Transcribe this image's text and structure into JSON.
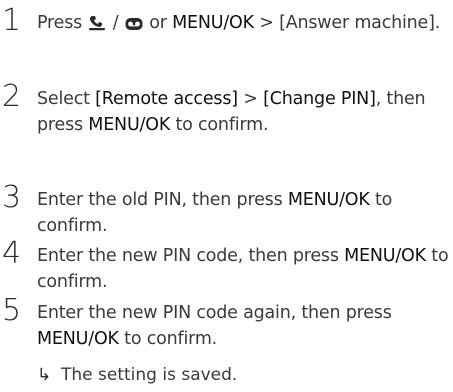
{
  "steps": [
    {
      "number": "1",
      "parts": {
        "a": "Press ",
        "b": " / ",
        "c": " or ",
        "d": "MENU/OK",
        "e": " > [Answer machine]."
      },
      "icons": [
        "answer-machine-handset-icon",
        "voicemail-icon"
      ]
    },
    {
      "number": "2",
      "parts": {
        "a": "Select ",
        "b": "[Remote access]",
        "c": " > ",
        "d": "[Change PIN]",
        "e": ", then press ",
        "f": "MENU/OK",
        "g": " to confirm."
      }
    },
    {
      "number": "3",
      "parts": {
        "a": "Enter the old PIN, then press ",
        "b": "MENU/OK",
        "c": " to confirm."
      }
    },
    {
      "number": "4",
      "parts": {
        "a": "Enter the new PIN code, then press ",
        "b": "MENU/OK",
        "c": " to confirm."
      }
    },
    {
      "number": "5",
      "parts": {
        "a": "Enter the new PIN code again, then press ",
        "b": "MENU/OK",
        "c": " to confirm."
      },
      "result": {
        "arrow": "↳",
        "text": "The setting is saved."
      }
    }
  ],
  "colors": {
    "text": "#3a3a3a",
    "emphasis": "#111111"
  }
}
